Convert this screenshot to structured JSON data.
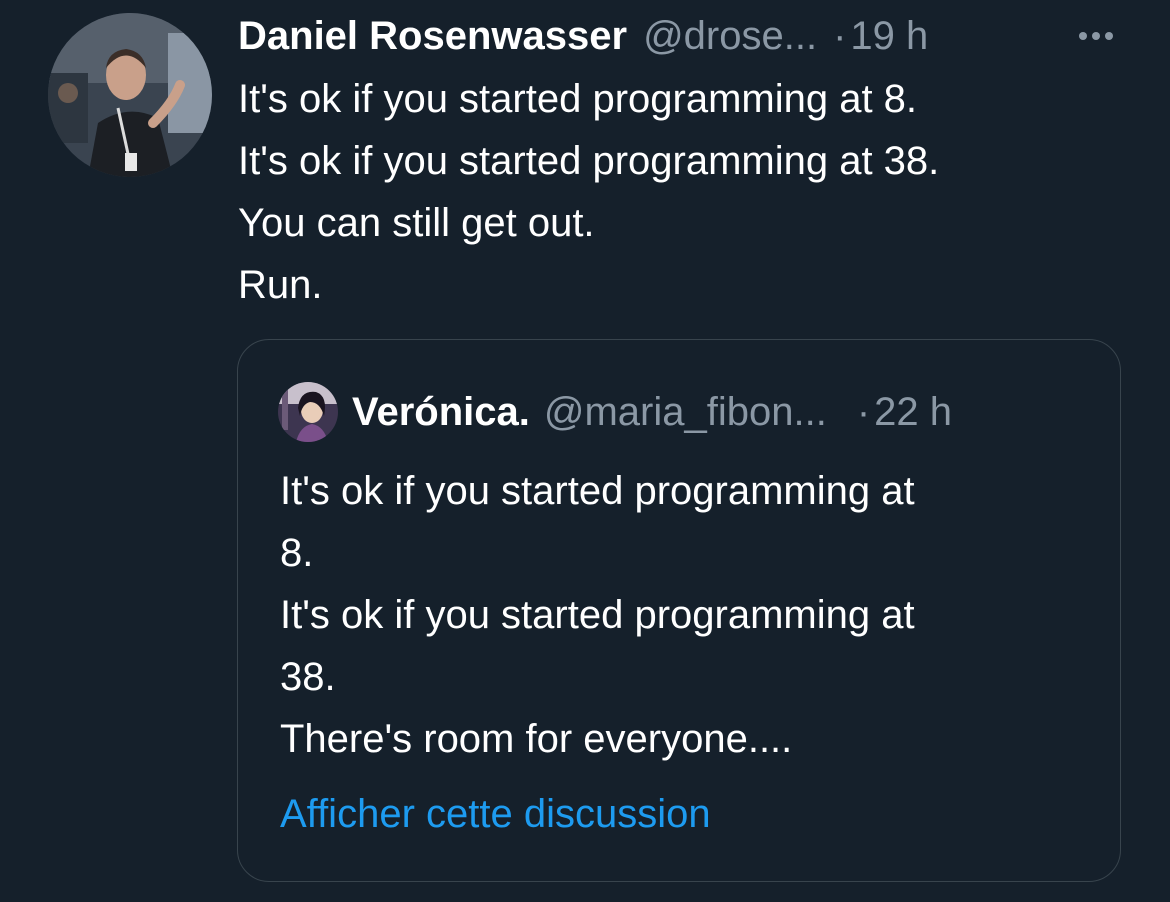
{
  "tweet": {
    "author": {
      "display_name": "Daniel Rosenwasser",
      "handle": "@drose...",
      "avatar_icon": "user-avatar-photo"
    },
    "separator": "·",
    "time": "19 h",
    "more_icon": "more-horizontal-icon",
    "lines": [
      "It's ok if you started programming at 8.",
      "It's ok if you started programming at 38.",
      "You can still get out.",
      "Run."
    ]
  },
  "quoted_tweet": {
    "author": {
      "display_name": "Verónica.",
      "handle": "@maria_fibon...",
      "avatar_icon": "user-avatar-illustration"
    },
    "separator": "·",
    "time": "22 h",
    "lines": [
      "It's ok if you started programming at",
      "8.",
      "It's ok if you started programming at",
      "38.",
      "There's room for everyone...."
    ],
    "show_thread_link": "Afficher cette discussion"
  },
  "colors": {
    "background": "#15202b",
    "text_primary": "#ffffff",
    "text_secondary": "#8b98a5",
    "border": "#38444d",
    "link": "#1d9bf0"
  }
}
